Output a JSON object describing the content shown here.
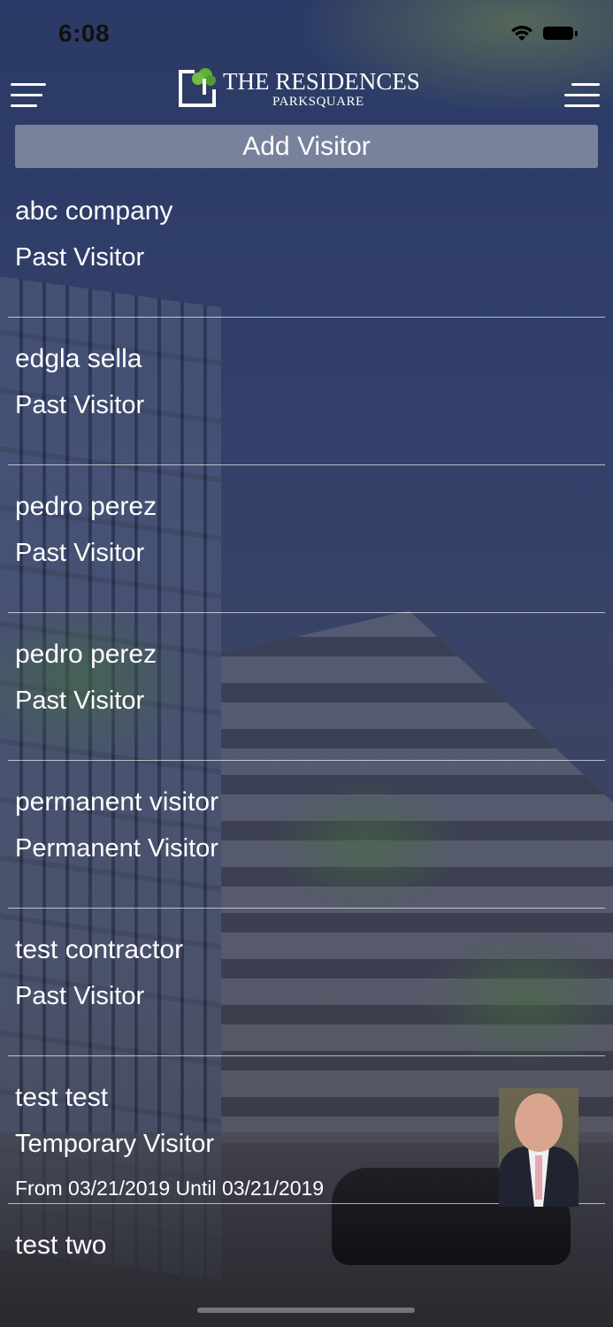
{
  "status_bar": {
    "time": "6:08"
  },
  "header": {
    "logo_title": "THE RESIDENCES",
    "logo_subtitle": "PARKSQUARE",
    "left_menu_icon": "hamburger-menu-icon",
    "right_menu_icon": "hamburger-menu-icon"
  },
  "add_visitor": {
    "label": "Add Visitor"
  },
  "visitors": [
    {
      "name": "abc company",
      "type": "Past Visitor"
    },
    {
      "name": "edgla sella",
      "type": "Past Visitor"
    },
    {
      "name": "pedro perez",
      "type": "Past Visitor"
    },
    {
      "name": "pedro perez",
      "type": "Past Visitor"
    },
    {
      "name": "permanent visitor",
      "type": "Permanent Visitor"
    },
    {
      "name": "test contractor",
      "type": "Past Visitor"
    },
    {
      "name": "test test",
      "type": "Temporary Visitor",
      "dates": "From 03/21/2019 Until 03/21/2019",
      "has_photo": true
    },
    {
      "name": "test two",
      "type": ""
    }
  ],
  "colors": {
    "button_bg": "#969eb2",
    "logo_green": "#5fae3a",
    "text": "#ffffff"
  }
}
